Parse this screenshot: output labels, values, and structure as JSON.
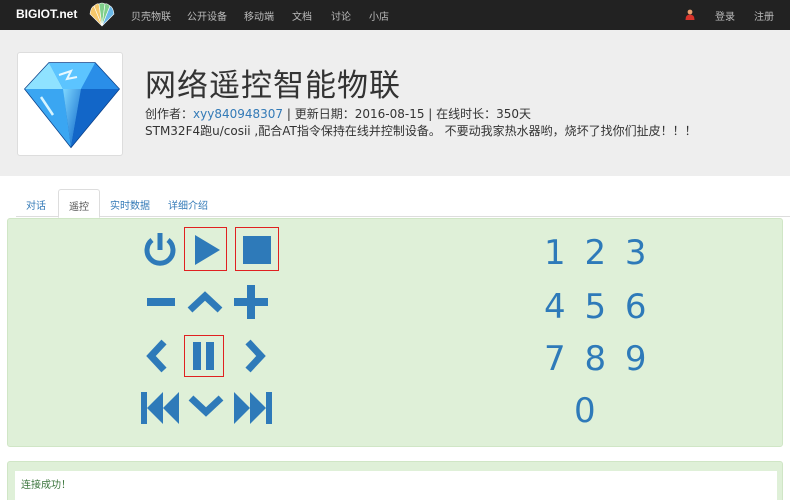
{
  "navbar": {
    "brand": "BIGIOT.net",
    "items": [
      "贝壳物联",
      "公开设备",
      "移动端",
      "文档",
      "讨论",
      "小店"
    ],
    "login": "登录",
    "signup": "注册"
  },
  "device": {
    "title": "网络遥控智能物联",
    "author_label": "创作者：",
    "author": "xyy840948307",
    "update_label": " | 更新日期：2016-08-15 | 在线时长：350天",
    "description": "STM32F4跑u/cosii ,配合AT指令保持在线并控制设备。 不要动我家热水器哟，烧坏了找你们扯皮！！！"
  },
  "tabs": [
    "对话",
    "遥控",
    "实时数据",
    "详细介绍"
  ],
  "active_tab": "遥控",
  "controls": {
    "icons": [
      "power-icon",
      "play-icon",
      "stop-icon",
      "minus-icon",
      "chevron-up-icon",
      "plus-icon",
      "chevron-left-icon",
      "pause-icon",
      "chevron-right-icon",
      "skip-backward-icon",
      "chevron-down-icon",
      "skip-forward-icon"
    ],
    "numpad": [
      "1 2 3",
      "4 5 6",
      "7 8 9",
      "0"
    ]
  },
  "log": {
    "message": "连接成功！"
  },
  "colors": {
    "navbar": "#222222",
    "control_blue": "#2e7ab9",
    "panel_green": "#dff0d8",
    "highlight_red": "#e02020",
    "link": "#337ab7"
  }
}
